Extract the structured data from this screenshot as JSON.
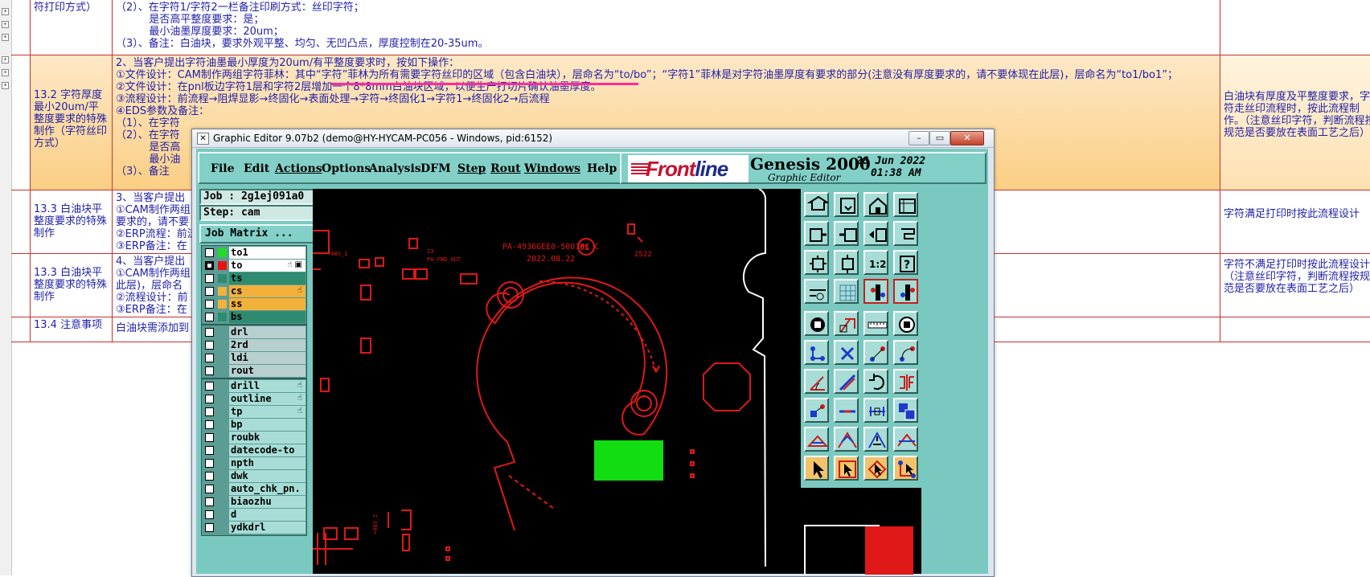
{
  "document": {
    "rows": [
      {
        "c1": "符打印方式）",
        "c2": "（2）、在字符1/字符2一栏备注印刷方式：丝印字符；\n          是否高平整度要求：是；\n          最小油墨厚度要求：20um；\n（3）、备注：白油块，要求外观平整、均匀、无凹凸点，厚度控制在20-35um。",
        "c3": ""
      },
      {
        "c1": "13.2 字符厚度最小20um/平整度要求的特殊制作（字符丝印方式）",
        "c2": "2、当客户提出字符油墨最小厚度为20um/有平整度要求时，按如下操作：\n①文件设计：CAM制作两组字符菲林：其中“字符”菲林为所有需要字符丝印的区域（包含白油块），层命名为“to/bo”；“字符1”菲林是对字符油墨厚度有要求的部分(注意没有厚度要求的，请不要体现在此层)，层命名为“to1/bo1”；\n②文件设计：在pnl板边字符1层和字符2层增加一个8*8mm白油块区域，以便生产打切片确认油墨厚度。\n③流程设计：前流程→阻焊显影→终固化→表面处理→字符→终固化1→字符1→终固化2→后流程\n④EDS参数及备注：\n（1）、在字符\n（2）、在字符\n          是否高\n          最小油\n（3）、备注",
        "c3": "白油块有厚度及平整度要求，字符走丝印流程时，按此流程制作。（注意丝印字符，判断流程按规范是否要放在表面工艺之后）"
      },
      {
        "c1": "13.3 白油块平整度要求的特殊制作",
        "c2": "3、当客户提出                                                                                                                   度有要求的相关区域(注意没有平整度\n①CAM制作两组\n要求的，请不要\n②ERP流程：前流\n③ERP备注：在",
        "c3": "字符满足打印时按此流程设计"
      },
      {
        "c1": "13.3 白油块平整度要求的特殊制作",
        "c2": "4、当客户提出                                                                                                                   意没有平整度要求的，请不要体现在\n①CAM制作两组\n此层)，层命名\n②流程设计：前\n③ERP备注：在",
        "c3": "字符不满足打印时按此流程设计（注意丝印字符，判断流程按规范是否要放在表面工艺之后）"
      },
      {
        "c1": "13.4 注意事项",
        "c2": "白油块需添加到                                                                                                                     求。",
        "c3": ""
      }
    ]
  },
  "window": {
    "title": "Graphic Editor 9.07b2 (demo@HY-HYCAM-PC056 - Windows, pid:6152)",
    "minimize": "–",
    "restore": "▭",
    "close": "✕"
  },
  "menu": [
    "File",
    "Edit",
    "Actions",
    "Options",
    "Analysis",
    "DFM",
    "Step",
    "Rout",
    "Windows",
    "Help"
  ],
  "brand": {
    "logo_a": "Front",
    "logo_b": "line",
    "product": "Genesis 2000",
    "subtitle": "Graphic Editor",
    "date": "28 Jun 2022",
    "time": "01:38 AM"
  },
  "job": {
    "job_label": "Job : 2g1ej091a0",
    "step_label": "Step: cam",
    "matrix_button": "Job Matrix ..."
  },
  "layers_a": [
    {
      "name": "to1",
      "color": "#22dd22",
      "on": false,
      "hand": ""
    },
    {
      "name": "to",
      "color": "#ee1111",
      "on": true,
      "hand": "☝ ▣"
    },
    {
      "name": "ts",
      "color": "#2e8b6f",
      "on": false,
      "hand": ""
    },
    {
      "name": "cs",
      "color": "#f2b13a",
      "on": false,
      "hand": "☝"
    },
    {
      "name": "ss",
      "color": "#f2b13a",
      "on": false,
      "hand": ""
    },
    {
      "name": "bs",
      "color": "#2e8b6f",
      "on": false,
      "hand": ""
    }
  ],
  "layers_b": [
    {
      "name": "drl",
      "hand": ""
    },
    {
      "name": "2rd",
      "hand": ""
    },
    {
      "name": "ldi",
      "hand": ""
    },
    {
      "name": "rout",
      "hand": ""
    }
  ],
  "layers_c": [
    {
      "name": "drill",
      "hand": "☝"
    },
    {
      "name": "outline",
      "hand": "☝"
    },
    {
      "name": "tp",
      "hand": "☝"
    },
    {
      "name": "bp",
      "hand": ""
    },
    {
      "name": "roubk",
      "hand": ""
    },
    {
      "name": "datecode-to",
      "hand": ""
    },
    {
      "name": "npth",
      "hand": ""
    },
    {
      "name": "dwk",
      "hand": ""
    },
    {
      "name": "auto_chk_pn.",
      "hand": ""
    },
    {
      "name": "biaozhu",
      "hand": ""
    },
    {
      "name": "d",
      "hand": ""
    },
    {
      "name": "ydkdrl",
      "hand": ""
    }
  ],
  "canvas": {
    "part_text": "PA-4936GEE0-5001PC C",
    "date_text": "2022.08.22",
    "circle_text": "01",
    "code_text": "2522",
    "small_label_1": "+48V_1",
    "small_label_2": "23",
    "small_label_3": "PA_FWD_OUT",
    "small_label_4": "+48V_2",
    "colors": {
      "copper": "#e01818",
      "fill": "#11dd11",
      "outline": "#ffffff"
    }
  },
  "tools": [
    {
      "name": "open-job-icon"
    },
    {
      "name": "save-job-icon"
    },
    {
      "name": "home-icon"
    },
    {
      "name": "grid-view-icon"
    },
    {
      "name": "zoom-in-icon"
    },
    {
      "name": "zoom-out-icon"
    },
    {
      "name": "pan-icon"
    },
    {
      "name": "snap-icon"
    },
    {
      "name": "fit-icon"
    },
    {
      "name": "center-icon"
    },
    {
      "name": "scale-1-2-icon"
    },
    {
      "name": "help-icon"
    },
    {
      "name": "measure-icon"
    },
    {
      "name": "grid-icon"
    },
    {
      "name": "layer-display-icon"
    },
    {
      "name": "layer-select-icon"
    },
    {
      "name": "pad-icon"
    },
    {
      "name": "polygon-icon"
    },
    {
      "name": "ruler-icon"
    },
    {
      "name": "circle-icon"
    },
    {
      "name": "connect-icon"
    },
    {
      "name": "cross-icon"
    },
    {
      "name": "line-icon"
    },
    {
      "name": "arc-icon"
    },
    {
      "name": "angle-icon"
    },
    {
      "name": "slash-icon"
    },
    {
      "name": "rotate-icon"
    },
    {
      "name": "mirror-icon"
    },
    {
      "name": "move-icon"
    },
    {
      "name": "minus-icon"
    },
    {
      "name": "width-icon"
    },
    {
      "name": "copy-icon"
    },
    {
      "name": "triangle-icon"
    },
    {
      "name": "triangle-edit-icon"
    },
    {
      "name": "arch-icon"
    },
    {
      "name": "triangle-up-icon"
    },
    {
      "name": "pointer-icon"
    },
    {
      "name": "select-icon"
    },
    {
      "name": "select-box-icon"
    },
    {
      "name": "net-icon"
    }
  ],
  "help_glyph": "?",
  "scale_text": "1:2"
}
